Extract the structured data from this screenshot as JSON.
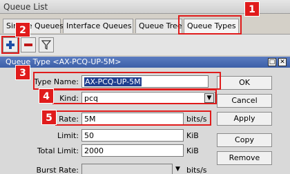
{
  "window": {
    "title": "Queue List"
  },
  "tabs": [
    {
      "label": "Simple Queues"
    },
    {
      "label": "Interface Queues"
    },
    {
      "label": "Queue Tree"
    },
    {
      "label": "Queue Types"
    }
  ],
  "toolbar": {
    "add_icon": "plus-icon",
    "remove_icon": "minus-icon",
    "filter_icon": "filter-icon"
  },
  "dialog": {
    "title": "Queue Type <AX-PCQ-UP-5M>",
    "fields": {
      "type_name": {
        "label": "Type Name:",
        "value": "AX-PCQ-UP-5M"
      },
      "kind": {
        "label": "Kind:",
        "value": "pcq"
      },
      "rate": {
        "label": "Rate:",
        "value": "5M",
        "unit": "bits/s"
      },
      "limit": {
        "label": "Limit:",
        "value": "50",
        "unit": "KiB"
      },
      "total_limit": {
        "label": "Total Limit:",
        "value": "2000",
        "unit": "KiB"
      },
      "burst_rate": {
        "label": "Burst Rate:",
        "value": "",
        "unit": "bits/s"
      }
    },
    "buttons": {
      "ok": "OK",
      "cancel": "Cancel",
      "apply": "Apply",
      "copy": "Copy",
      "remove": "Remove"
    }
  },
  "callouts": [
    "1",
    "2",
    "3",
    "4",
    "5"
  ],
  "colors": {
    "accent": "#e01b1b",
    "titlebar": "#3c5fa8",
    "selection": "#1f3f8f"
  }
}
